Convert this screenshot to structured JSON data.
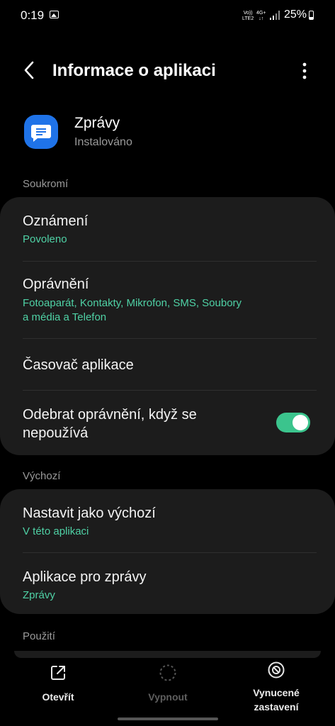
{
  "status_bar": {
    "time": "0:19",
    "network_top": "Vo))",
    "network_bottom": "LTE2",
    "network2_top": "4G+",
    "network2_bottom": "↓↑",
    "battery": "25%"
  },
  "header": {
    "title": "Informace o aplikaci"
  },
  "app": {
    "name": "Zprávy",
    "status": "Instalováno",
    "icon_color": "#1f73e8"
  },
  "sections": {
    "privacy": {
      "label": "Soukromí",
      "notifications": {
        "title": "Oznámení",
        "subtitle": "Povoleno"
      },
      "permissions": {
        "title": "Oprávnění",
        "subtitle_line1": "Fotoaparát, Kontakty, Mikrofon, SMS, Soubory",
        "subtitle_line2": "a média a Telefon"
      },
      "app_timer": {
        "title": "Časovač aplikace"
      },
      "remove_permissions": {
        "title_line1": "Odebrat oprávnění, když se",
        "title_line2": "nepoužívá",
        "enabled": true
      }
    },
    "defaults": {
      "label": "Výchozí",
      "set_default": {
        "title": "Nastavit jako výchozí",
        "subtitle": "V této aplikaci"
      },
      "messaging_app": {
        "title": "Aplikace pro zprávy",
        "subtitle": "Zprávy"
      }
    },
    "usage": {
      "label": "Použití"
    }
  },
  "bottom_bar": {
    "open": {
      "label": "Otevřít",
      "icon": "open-external-icon"
    },
    "disable": {
      "label": "Vypnout",
      "icon": "disable-icon"
    },
    "force_stop": {
      "label_line1": "Vynucené",
      "label_line2": "zastavení",
      "icon": "force-stop-icon"
    }
  },
  "colors": {
    "accent": "#4fd1a5",
    "toggle_on": "#3bc48d",
    "card_bg": "#1c1c1c"
  }
}
